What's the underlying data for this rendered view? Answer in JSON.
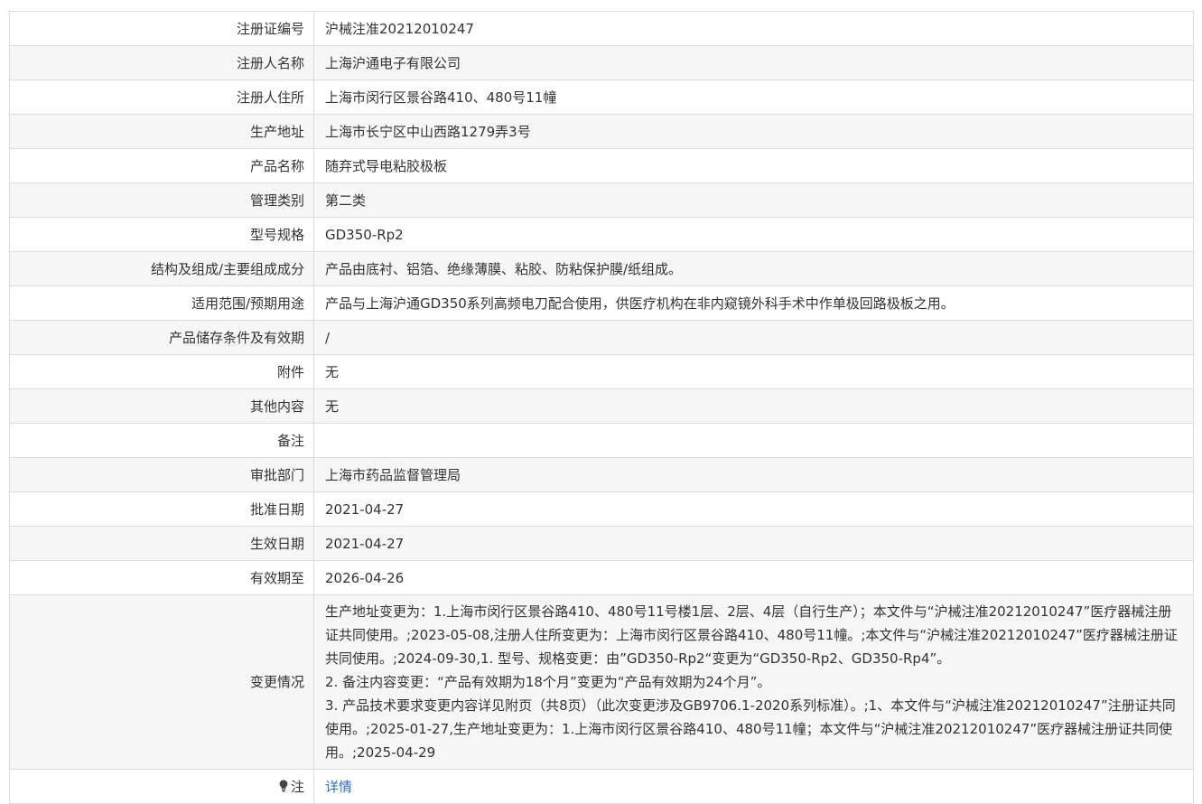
{
  "rows": [
    {
      "label": "注册证编号",
      "value": "沪械注准20212010247"
    },
    {
      "label": "注册人名称",
      "value": "上海沪通电子有限公司"
    },
    {
      "label": "注册人住所",
      "value": "上海市闵行区景谷路410、480号11幢"
    },
    {
      "label": "生产地址",
      "value": "上海市长宁区中山西路1279弄3号"
    },
    {
      "label": "产品名称",
      "value": "随弃式导电粘胶极板"
    },
    {
      "label": "管理类别",
      "value": "第二类"
    },
    {
      "label": "型号规格",
      "value": "GD350-Rp2"
    },
    {
      "label": "结构及组成/主要组成成分",
      "value": "产品由底衬、铝箔、绝缘薄膜、粘胶、防粘保护膜/纸组成。"
    },
    {
      "label": "适用范围/预期用途",
      "value": "产品与上海沪通GD350系列高频电刀配合使用，供医疗机构在非内窥镜外科手术中作单极回路极板之用。"
    },
    {
      "label": "产品储存条件及有效期",
      "value": "/"
    },
    {
      "label": "附件",
      "value": "无"
    },
    {
      "label": "其他内容",
      "value": "无"
    },
    {
      "label": "备注",
      "value": ""
    },
    {
      "label": "审批部门",
      "value": "上海市药品监督管理局"
    },
    {
      "label": "批准日期",
      "value": "2021-04-27"
    },
    {
      "label": "生效日期",
      "value": "2021-04-27"
    },
    {
      "label": "有效期至",
      "value": "2026-04-26"
    }
  ],
  "changes": {
    "label": "变更情况",
    "line1": "生产地址变更为：1.上海市闵行区景谷路410、480号11号楼1层、2层、4层（自行生产）；本文件与“沪械注准20212010247”医疗器械注册证共同使用。;2023-05-08,注册人住所变更为：上海市闵行区景谷路410、480号11幢。;本文件与“沪械注准20212010247”医疗器械注册证共同使用。;2024-09-30,1. 型号、规格变更：由”GD350-Rp2“变更为“GD350-Rp2、GD350-Rp4”。",
    "line2": "2. 备注内容变更：“产品有效期为18个月”变更为“产品有效期为24个月”。",
    "line3": "3. 产品技术要求变更内容详见附页（共8页）（此次变更涉及GB9706.1-2020系列标准）。;1、本文件与“沪械注准20212010247”注册证共同使用。;2025-01-27,生产地址变更为：1.上海市闵行区景谷路410、480号11幢；本文件与“沪械注准20212010247”医疗器械注册证共同使用。;2025-04-29"
  },
  "note": {
    "label": "注",
    "link": "详情",
    "icon": "lightbulb-icon"
  },
  "colors": {
    "border": "#dddddd",
    "stripe": "#f6f6f6",
    "link": "#2a6fd1"
  }
}
